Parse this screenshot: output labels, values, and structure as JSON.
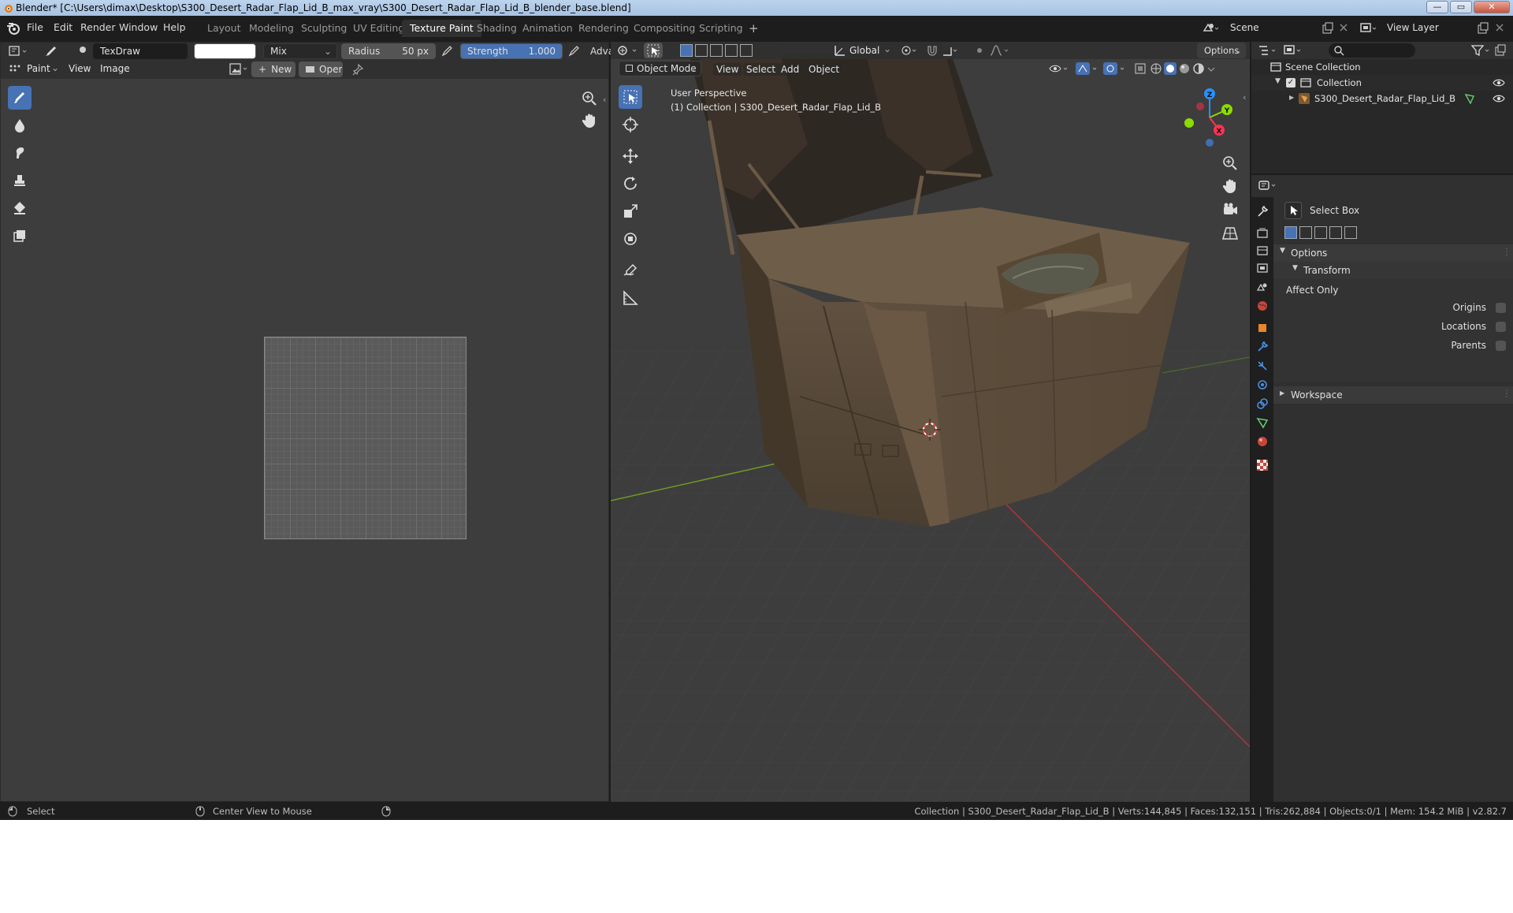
{
  "window": {
    "title": "Blender* [C:\\Users\\dimax\\Desktop\\S300_Desert_Radar_Flap_Lid_B_max_vray\\S300_Desert_Radar_Flap_Lid_B_blender_base.blend]",
    "controls": [
      "—",
      "▭",
      "✕"
    ]
  },
  "menubar": {
    "items": [
      "File",
      "Edit",
      "Render",
      "Window",
      "Help"
    ]
  },
  "workspaces": {
    "tabs": [
      "Layout",
      "Modeling",
      "Sculpting",
      "UV Editing",
      "Texture Paint",
      "Shading",
      "Animation",
      "Rendering",
      "Compositing",
      "Scripting"
    ],
    "active": "Texture Paint",
    "add": "+"
  },
  "scene": {
    "name": "Scene",
    "view_layer": "View Layer"
  },
  "brush_header": {
    "brush_name": "TexDraw",
    "blend_mode": "Mix",
    "radius_label": "Radius",
    "radius_value": "50 px",
    "strength_label": "Strength",
    "strength_value": "1.000",
    "strength_fraction": 1.0,
    "advanced": "Adva",
    "brush_color": "#ffffff"
  },
  "image_editor": {
    "mode": "Paint",
    "menus": [
      "View",
      "Image"
    ],
    "new_label": "New",
    "open_label": "Open",
    "tools": [
      "draw-brush-icon",
      "soften-icon",
      "smear-icon",
      "clone-icon",
      "fill-icon",
      "mask-icon"
    ]
  },
  "viewport": {
    "header": {
      "mode": "Object Mode",
      "menus": [
        "View",
        "Select",
        "Add",
        "Object"
      ],
      "orientation": "Global",
      "options": "Options"
    },
    "overlay_text": {
      "perspective": "User Perspective",
      "collection": "(1) Collection | S300_Desert_Radar_Flap_Lid_B"
    },
    "gizmo_axes": [
      "X",
      "Y",
      "Z"
    ],
    "tools": [
      "select-box-icon",
      "cursor-icon",
      "move-icon",
      "rotate-icon",
      "scale-icon",
      "transform-icon",
      "annotate-icon",
      "measure-icon"
    ]
  },
  "outliner": {
    "root": "Scene Collection",
    "collection": "Collection",
    "object": "S300_Desert_Radar_Flap_Lid_B"
  },
  "properties": {
    "tool_name": "Select Box",
    "options_label": "Options",
    "transform_label": "Transform",
    "affect_only_label": "Affect Only",
    "checkboxes": [
      {
        "label": "Origins",
        "checked": false
      },
      {
        "label": "Locations",
        "checked": false
      },
      {
        "label": "Parents",
        "checked": false
      }
    ],
    "workspace_label": "Workspace"
  },
  "statusbar": {
    "left_action": "Select",
    "middle_action": "Center View to Mouse",
    "stats": "Collection | S300_Desert_Radar_Flap_Lid_B | Verts:144,845 | Faces:132,151 | Tris:262,884 | Objects:0/1 | Mem: 154.2 MiB | v2.82.7"
  },
  "colors": {
    "accent": "#4772b3",
    "axis_x": "#ff3352",
    "axis_y": "#8bdc00",
    "axis_z": "#2890ff",
    "model": "#5e4f3c"
  }
}
